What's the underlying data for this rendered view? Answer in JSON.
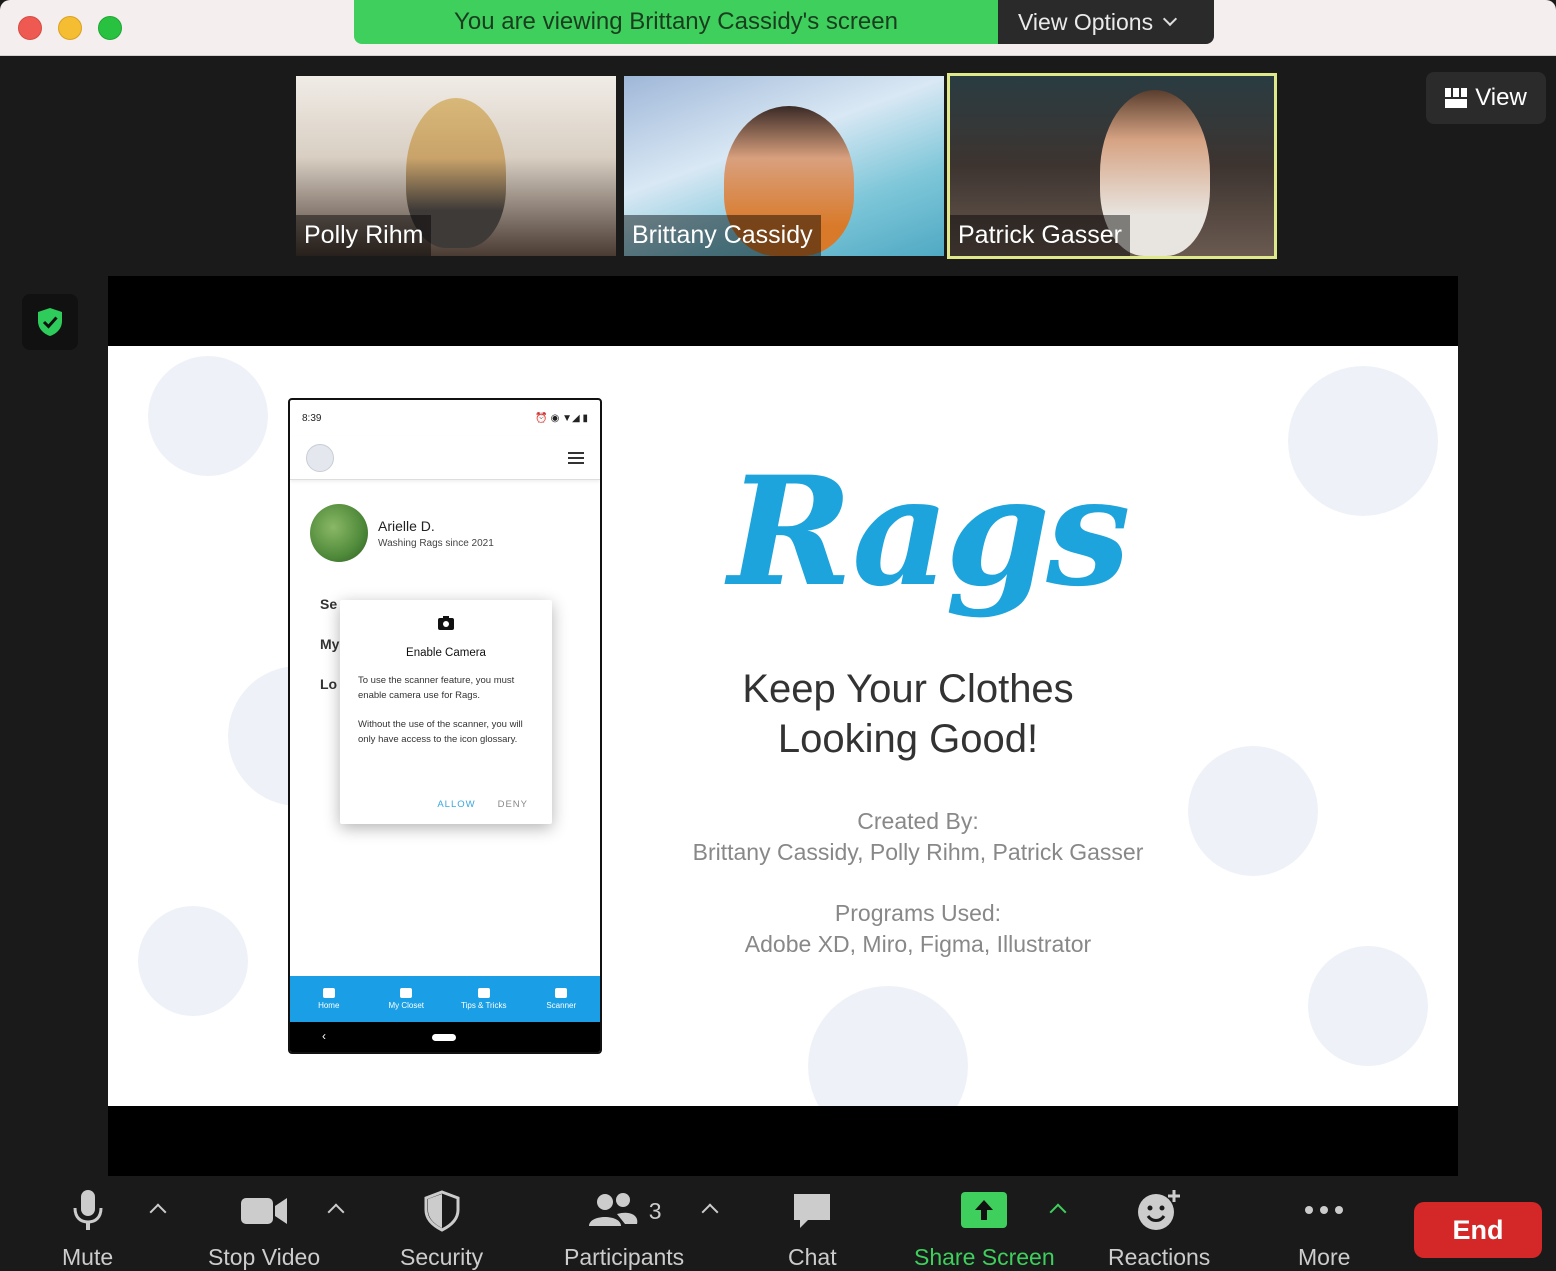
{
  "banner": {
    "message": "You are viewing Brittany Cassidy's screen",
    "view_options": "View Options"
  },
  "participants": [
    {
      "name": "Polly Rihm"
    },
    {
      "name": "Brittany Cassidy"
    },
    {
      "name": "Patrick Gasser"
    }
  ],
  "view_button": "View",
  "phone": {
    "time": "8:39",
    "user_name": "Arielle D.",
    "user_since": "Washing Rags since 2021",
    "menu_partial": [
      "Se",
      "My",
      "Lo"
    ],
    "dialog": {
      "title": "Enable Camera",
      "text1": "To use the scanner feature, you must enable camera use for Rags.",
      "text2": "Without the use of the scanner, you will only have access to the icon glossary.",
      "allow": "ALLOW",
      "deny": "DENY"
    },
    "tabs": [
      "Home",
      "My Closet",
      "Tips & Tricks",
      "Scanner"
    ]
  },
  "slide": {
    "logo": "Rags",
    "tagline_1": "Keep Your Clothes",
    "tagline_2": "Looking Good!",
    "created_label": "Created By:",
    "created_names": "Brittany Cassidy, Polly Rihm, Patrick Gasser",
    "programs_label": "Programs Used:",
    "programs_list": "Adobe XD, Miro, Figma, Illustrator"
  },
  "toolbar": {
    "mute": "Mute",
    "stop_video": "Stop Video",
    "security": "Security",
    "participants": "Participants",
    "participants_count": "3",
    "chat": "Chat",
    "share_screen": "Share Screen",
    "reactions": "Reactions",
    "more": "More",
    "end": "End"
  },
  "colors": {
    "accent_green": "#3ecf5c",
    "end_red": "#d42727",
    "rags_blue": "#1ea4dc"
  }
}
